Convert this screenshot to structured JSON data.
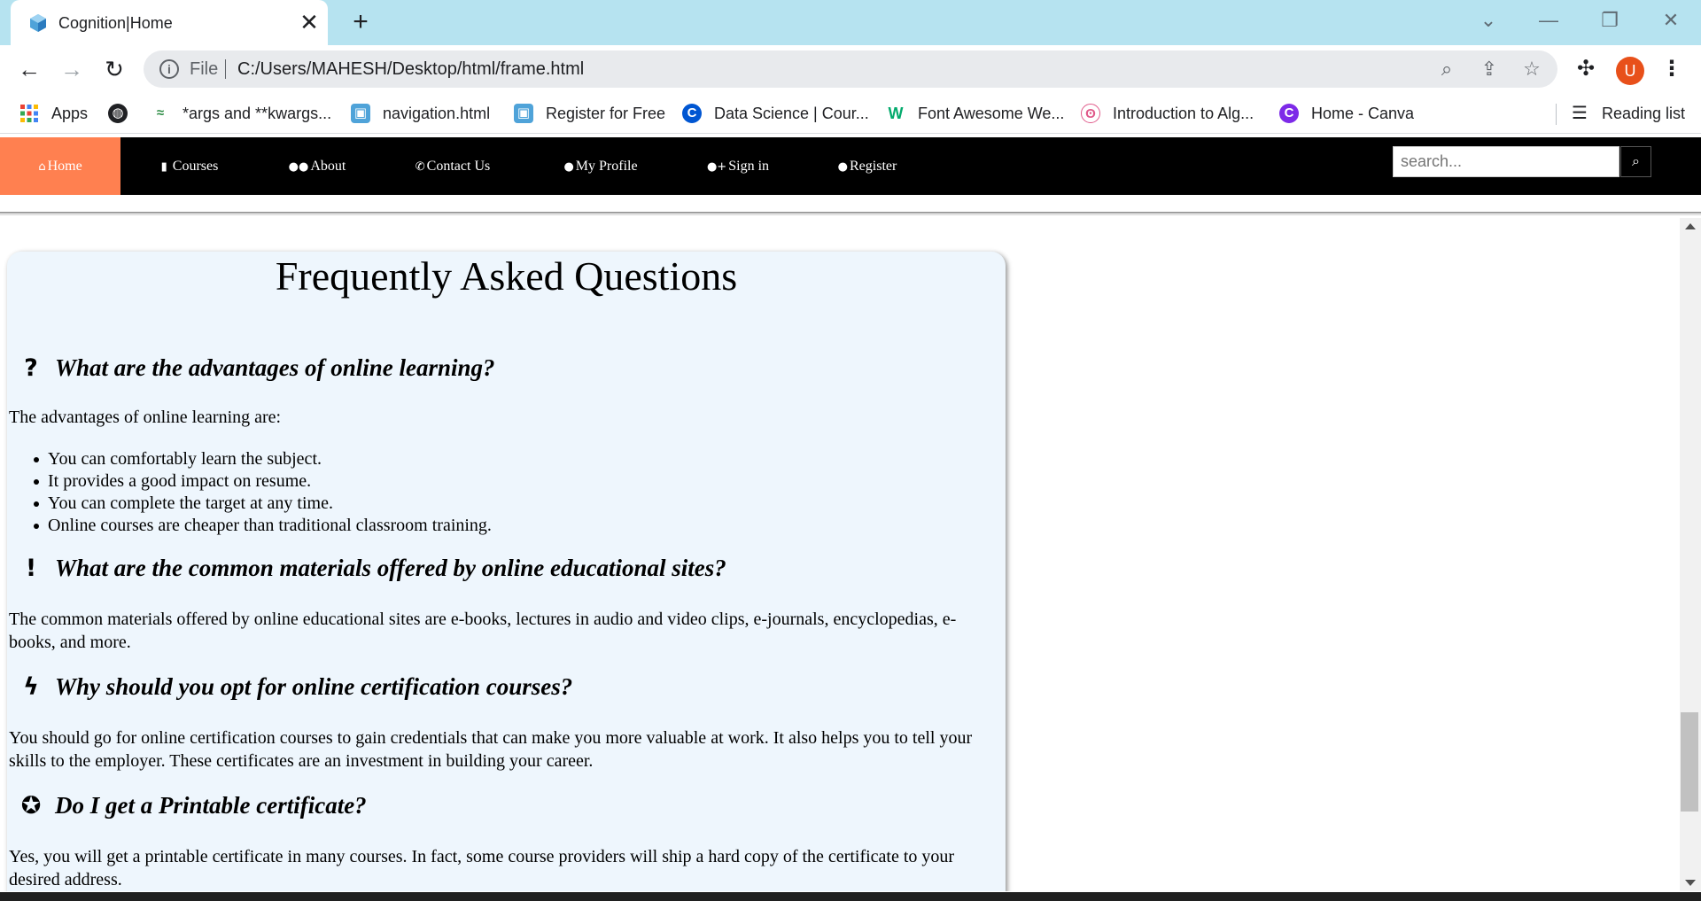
{
  "browser": {
    "tab_title": "Cognition|Home",
    "new_tab_symbol": "+",
    "close_symbol": "✕",
    "omnibox": {
      "scheme_label": "File",
      "url": "C:/Users/MAHESH/Desktop/html/frame.html"
    },
    "profile_initial": "U"
  },
  "bookmarks": [
    {
      "label": "Apps",
      "icon": "apps-grid-icon"
    },
    {
      "label": "*args and **kwargs...",
      "icon": "geeksforgeeks-icon"
    },
    {
      "label": "navigation.html",
      "icon": "cube-icon"
    },
    {
      "label": "Register for Free",
      "icon": "cube-icon"
    },
    {
      "label": "Data Science | Cour...",
      "icon": "coursera-icon"
    },
    {
      "label": "Font Awesome We...",
      "icon": "w3schools-icon"
    },
    {
      "label": "Introduction to Alg...",
      "icon": "brain-icon"
    },
    {
      "label": "Home - Canva",
      "icon": "canva-icon"
    }
  ],
  "reading_list": "Reading list",
  "sitenav": {
    "items": [
      {
        "label": "Home",
        "icon": "home-icon",
        "active": true
      },
      {
        "label": " Courses",
        "icon": "book-icon"
      },
      {
        "label": "About",
        "icon": "users-icon"
      },
      {
        "label": "Contact Us",
        "icon": "phone-icon"
      },
      {
        "label": "My Profile",
        "icon": "user-icon"
      },
      {
        "label": "Sign in",
        "icon": "user-plus-icon"
      },
      {
        "label": "Register",
        "icon": "user-icon"
      }
    ],
    "search_placeholder": "search...",
    "accent_color": "#ff8050"
  },
  "faq": {
    "title": "Frequently Asked Questions",
    "q1": {
      "question": "What are the advantages of online learning?",
      "icon": "question-icon",
      "intro": "The advantages of online learning are:",
      "points": [
        "You can comfortably learn the subject.",
        "It provides a good impact on resume.",
        "You can complete the target at any time.",
        "Online courses are cheaper than traditional classroom training."
      ]
    },
    "q2": {
      "question": "What are the common materials offered by online educational sites?",
      "icon": "exclamation-icon",
      "answer": "The common materials offered by online educational sites are e-books, lectures in audio and video clips, e-journals, encyclopedias, e-books, and more."
    },
    "q3": {
      "question": "Why should you opt for online certification courses?",
      "icon": "bolt-icon",
      "answer": "You should go for online certification courses to gain credentials that can make you more valuable at work. It also helps you to tell your skills to the employer. These certificates are an investment in building your career."
    },
    "q4": {
      "question": "Do I get a Printable certificate?",
      "icon": "medal-icon",
      "answer": "Yes, you will get a printable certificate in many courses. In fact, some course providers will ship a hard copy of the certificate to your desired address."
    }
  }
}
